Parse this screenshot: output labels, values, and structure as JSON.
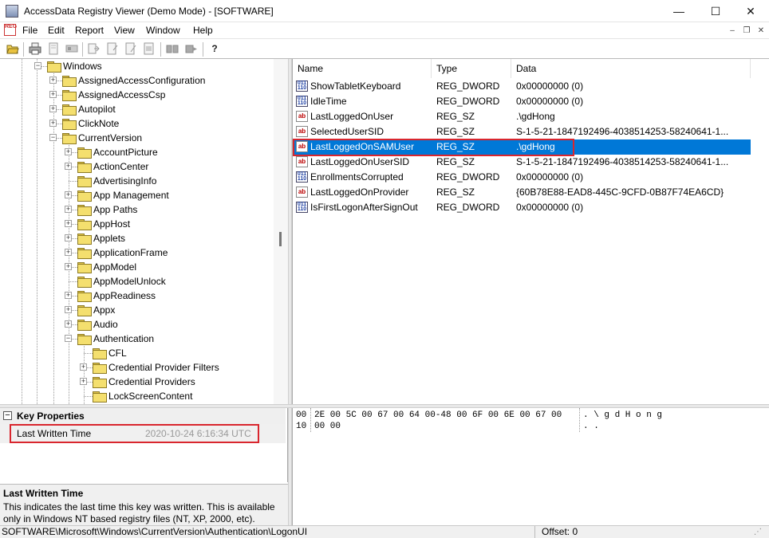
{
  "window": {
    "title": "AccessData Registry Viewer (Demo Mode) - [SOFTWARE]",
    "minimize": "—",
    "maximize": "☐",
    "close": "✕"
  },
  "menu": {
    "logo": "REG",
    "items": [
      "File",
      "Edit",
      "Report",
      "View",
      "Window",
      "Help"
    ],
    "mdi_min": "–",
    "mdi_restore": "❐",
    "mdi_close": "✕"
  },
  "toolbar": {
    "icons": [
      "open-folder-icon",
      "print-icon",
      "find-icon",
      "find-next-icon",
      "export-icon",
      "report-icon",
      "add-report-icon",
      "summary-icon",
      "previous-icon",
      "next-icon",
      "help-icon"
    ]
  },
  "tree": {
    "items": [
      {
        "label": "Windows",
        "level": 3,
        "expander": "minus"
      },
      {
        "label": "AssignedAccessConfiguration",
        "level": 4,
        "expander": "plus"
      },
      {
        "label": "AssignedAccessCsp",
        "level": 4,
        "expander": "plus"
      },
      {
        "label": "Autopilot",
        "level": 4,
        "expander": "plus"
      },
      {
        "label": "ClickNote",
        "level": 4,
        "expander": "plus"
      },
      {
        "label": "CurrentVersion",
        "level": 4,
        "expander": "minus"
      },
      {
        "label": "AccountPicture",
        "level": 5,
        "expander": "plus"
      },
      {
        "label": "ActionCenter",
        "level": 5,
        "expander": "plus"
      },
      {
        "label": "AdvertisingInfo",
        "level": 5,
        "expander": "none"
      },
      {
        "label": "App Management",
        "level": 5,
        "expander": "plus"
      },
      {
        "label": "App Paths",
        "level": 5,
        "expander": "plus"
      },
      {
        "label": "AppHost",
        "level": 5,
        "expander": "plus"
      },
      {
        "label": "Applets",
        "level": 5,
        "expander": "plus"
      },
      {
        "label": "ApplicationFrame",
        "level": 5,
        "expander": "plus"
      },
      {
        "label": "AppModel",
        "level": 5,
        "expander": "plus"
      },
      {
        "label": "AppModelUnlock",
        "level": 5,
        "expander": "none"
      },
      {
        "label": "AppReadiness",
        "level": 5,
        "expander": "plus"
      },
      {
        "label": "Appx",
        "level": 5,
        "expander": "plus"
      },
      {
        "label": "Audio",
        "level": 5,
        "expander": "plus"
      },
      {
        "label": "Authentication",
        "level": 5,
        "expander": "minus"
      },
      {
        "label": "CFL",
        "level": 6,
        "expander": "none"
      },
      {
        "label": "Credential Provider Filters",
        "level": 6,
        "expander": "plus"
      },
      {
        "label": "Credential Providers",
        "level": 6,
        "expander": "plus"
      },
      {
        "label": "LockScreenContent",
        "level": 6,
        "expander": "none"
      }
    ]
  },
  "list": {
    "columns": [
      "Name",
      "Type",
      "Data"
    ],
    "rows": [
      {
        "name": "ShowTabletKeyboard",
        "type": "REG_DWORD",
        "data": "0x00000000 (0)",
        "icon": "binary-value-icon",
        "selected": false
      },
      {
        "name": "IdleTime",
        "type": "REG_DWORD",
        "data": "0x00000000 (0)",
        "icon": "binary-value-icon",
        "selected": false
      },
      {
        "name": "LastLoggedOnUser",
        "type": "REG_SZ",
        "data": ".\\gdHong",
        "icon": "string-value-icon",
        "selected": false
      },
      {
        "name": "SelectedUserSID",
        "type": "REG_SZ",
        "data": "S-1-5-21-1847192496-4038514253-58240641-1...",
        "icon": "string-value-icon",
        "selected": false
      },
      {
        "name": "LastLoggedOnSAMUser",
        "type": "REG_SZ",
        "data": ".\\gdHong",
        "icon": "string-value-icon",
        "selected": true
      },
      {
        "name": "LastLoggedOnUserSID",
        "type": "REG_SZ",
        "data": "S-1-5-21-1847192496-4038514253-58240641-1...",
        "icon": "string-value-icon",
        "selected": false
      },
      {
        "name": "EnrollmentsCorrupted",
        "type": "REG_DWORD",
        "data": "0x00000000 (0)",
        "icon": "binary-value-icon",
        "selected": false
      },
      {
        "name": "LastLoggedOnProvider",
        "type": "REG_SZ",
        "data": "{60B78E88-EAD8-445C-9CFD-0B87F74EA6CD}",
        "icon": "string-value-icon",
        "selected": false
      },
      {
        "name": "IsFirstLogonAfterSignOut",
        "type": "REG_DWORD",
        "data": "0x00000000 (0)",
        "icon": "binary-value-icon",
        "selected": false
      }
    ]
  },
  "properties": {
    "header": "Key Properties",
    "collapse": "−",
    "row_label": "Last Written Time",
    "row_value": "2020-10-24 6:16:34 UTC"
  },
  "description": {
    "title": "Last Written Time",
    "text": "This indicates the last time this key was written. This is available only in Windows NT based registry files (NT, XP, 2000, etc)."
  },
  "hex": {
    "rows": [
      {
        "offset": "00",
        "bytes": "2E 00 5C 00 67 00 64 00-48 00 6F 00 6E 00 67 00",
        "ascii": ". \\ g d H o n g"
      },
      {
        "offset": "10",
        "bytes": "00 00",
        "ascii": ". ."
      }
    ]
  },
  "status": {
    "path": "SOFTWARE\\Microsoft\\Windows\\CurrentVersion\\Authentication\\LogonUI",
    "offset": "Offset: 0"
  }
}
